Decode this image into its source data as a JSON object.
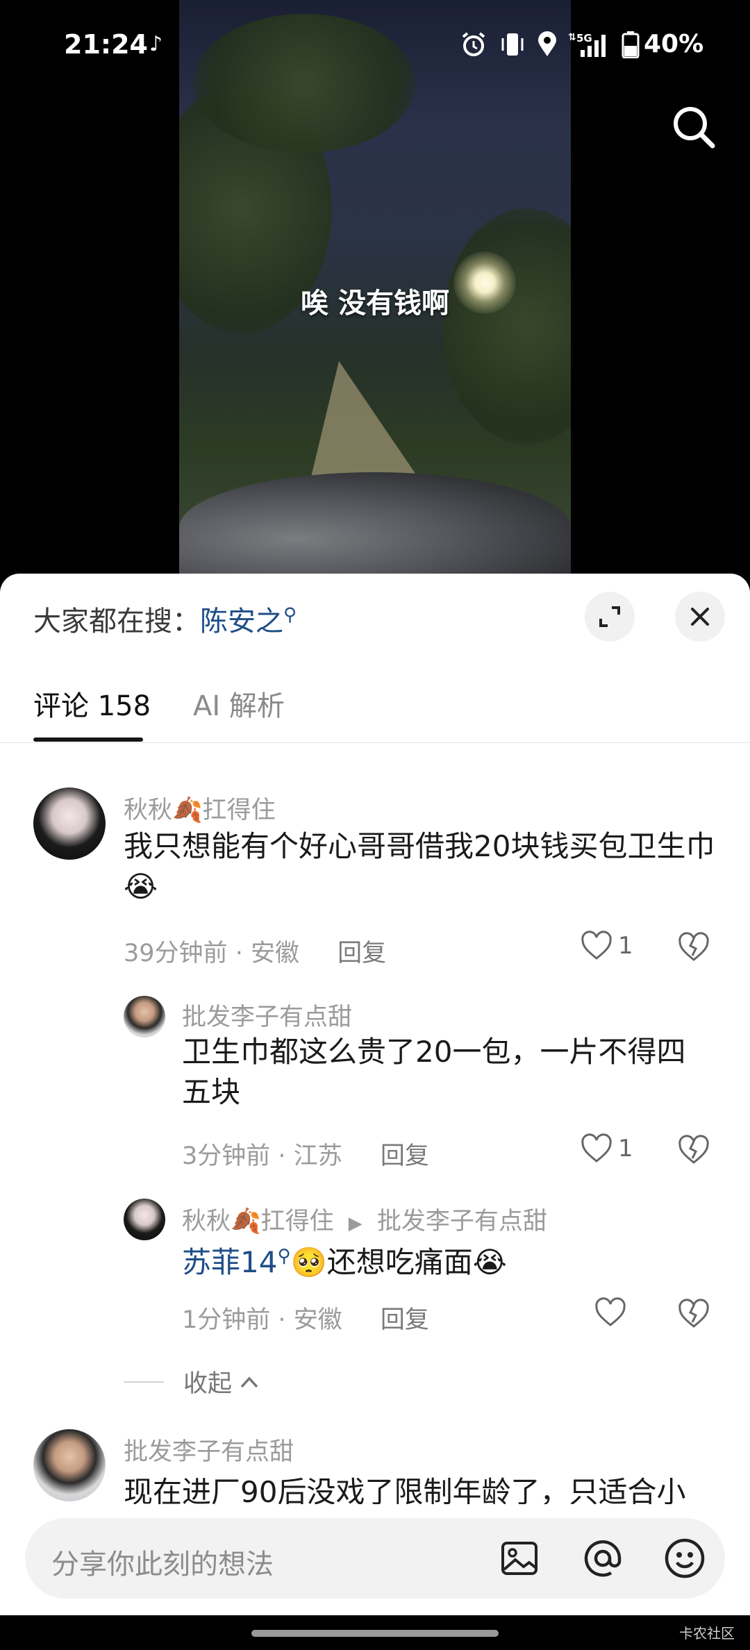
{
  "status_bar": {
    "time": "21:24",
    "network": "5G",
    "battery": "40%",
    "icons": [
      "tiktok-icon",
      "alarm-icon",
      "vibrate-icon",
      "location-icon",
      "signal-icon",
      "battery-icon"
    ]
  },
  "video": {
    "caption": "唉 没有钱啊"
  },
  "sheet": {
    "hot_search_prefix": "大家都在搜：",
    "hot_search_term": "陈安之",
    "tabs": {
      "comments": "评论 158",
      "ai": "AI 解析"
    }
  },
  "comments": [
    {
      "username": "秋秋🍂扛得住",
      "text": "我只想能有个好心哥哥借我20块钱买包卫生巾😭",
      "time": "39分钟前",
      "location": "安徽",
      "reply_label": "回复",
      "likes": "1"
    }
  ],
  "replies": [
    {
      "username": "批发李子有点甜",
      "text_line1": "卫生巾都这么贵了20一包，一片不得四",
      "text_line2": "五块",
      "time": "3分钟前",
      "location": "江苏",
      "reply_label": "回复",
      "likes": "1"
    },
    {
      "username": "秋秋🍂扛得住",
      "reply_to": "批发李子有点甜",
      "mention": "苏菲14",
      "text": "🥺还想吃痛面😭",
      "time": "1分钟前",
      "location": "安徽",
      "reply_label": "回复",
      "likes": ""
    }
  ],
  "collapse_label": "收起",
  "next_comment": {
    "username": "批发李子有点甜",
    "text": "现在进厂90后没戏了限制年龄了，只适合小"
  },
  "input": {
    "placeholder": "分享你此刻的想法"
  },
  "watermark": "卡农社区",
  "colors": {
    "link": "#1e4e86",
    "muted": "#9b9b9b"
  }
}
